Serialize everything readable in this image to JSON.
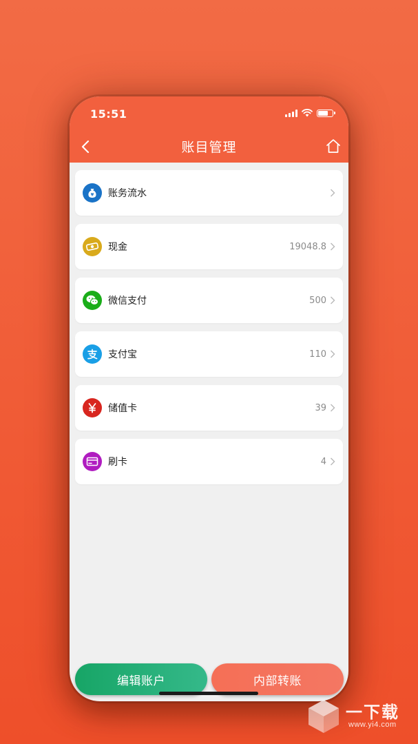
{
  "status": {
    "time": "15:51"
  },
  "header": {
    "title": "账目管理"
  },
  "accounts": [
    {
      "label": "账务流水",
      "value": "",
      "icon": "money-bag-icon",
      "color": "#1a73c7"
    },
    {
      "label": "现金",
      "value": "19048.8",
      "icon": "cash-icon",
      "color": "#d9aa1c"
    },
    {
      "label": "微信支付",
      "value": "500",
      "icon": "wechat-icon",
      "color": "#1aad19"
    },
    {
      "label": "支付宝",
      "value": "110",
      "icon": "alipay-icon",
      "color": "#1a9fe6"
    },
    {
      "label": "储值卡",
      "value": "39",
      "icon": "yuan-icon",
      "color": "#d8261f"
    },
    {
      "label": "刷卡",
      "value": "4",
      "icon": "card-icon",
      "color": "#b01cc0"
    }
  ],
  "buttons": {
    "edit": "编辑账户",
    "transfer": "内部转账"
  },
  "watermark": {
    "text": "一下载",
    "url": "www.yi4.com"
  }
}
